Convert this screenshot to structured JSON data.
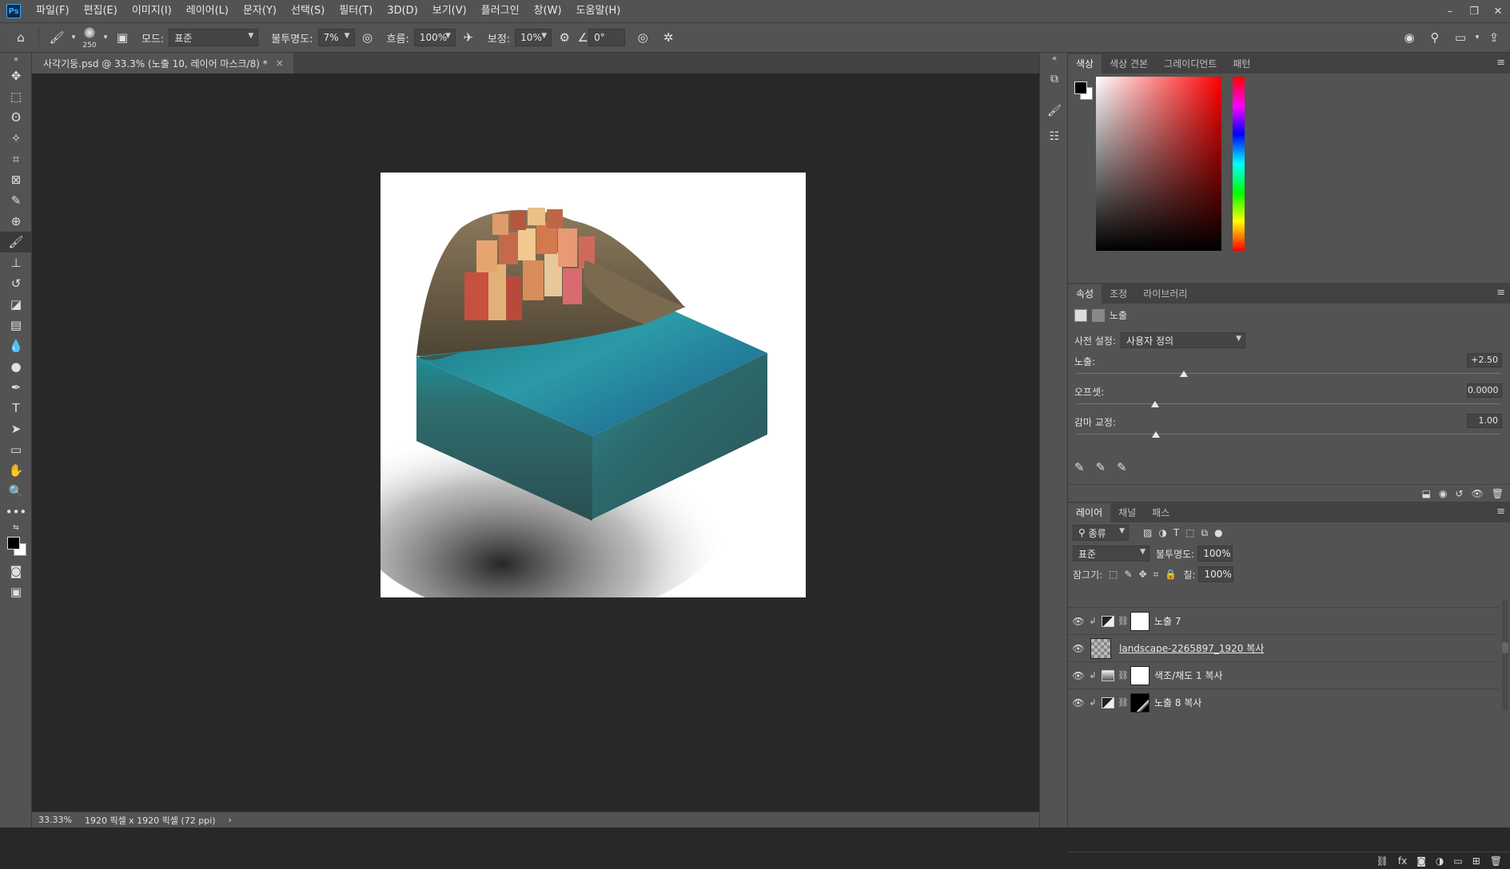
{
  "app": {
    "logo": "Ps"
  },
  "menu": [
    "파일(F)",
    "편집(E)",
    "이미지(I)",
    "레이어(L)",
    "문자(Y)",
    "선택(S)",
    "필터(T)",
    "3D(D)",
    "보기(V)",
    "플러그인",
    "창(W)",
    "도움말(H)"
  ],
  "window_controls": {
    "minimize": "–",
    "maximize": "❐",
    "close": "✕"
  },
  "options": {
    "brush_size": "250",
    "mode_label": "모드:",
    "mode_value": "표준",
    "opacity_label": "불투명도:",
    "opacity_value": "7%",
    "flow_label": "흐름:",
    "flow_value": "100%",
    "smoothing_label": "보정:",
    "smoothing_value": "10%",
    "angle_value": "0°"
  },
  "document": {
    "tab_title": "사각기둥.psd @ 33.3% (노출 10, 레이어 마스크/8) *",
    "close": "×"
  },
  "status": {
    "zoom": "33.33%",
    "doc_info": "1920 픽셀 x 1920 픽셀 (72 ppi)",
    "arrow": "›"
  },
  "color_panel": {
    "tabs": [
      "색상",
      "색상 견본",
      "그레이디언트",
      "패턴"
    ],
    "active_tab": 0
  },
  "properties_panel": {
    "tabs": [
      "속성",
      "조정",
      "라이브러리"
    ],
    "title": "노출",
    "preset_label": "사전 설정:",
    "preset_value": "사용자 정의",
    "exposure_label": "노출:",
    "exposure_value": "+2.50",
    "offset_label": "오프셋:",
    "offset_value": "0.0000",
    "gamma_label": "감마 교정:",
    "gamma_value": "1.00"
  },
  "layers_panel": {
    "tabs": [
      "레이어",
      "채널",
      "패스"
    ],
    "filter_value": "종류",
    "blend_value": "표준",
    "opacity_label": "불투명도:",
    "opacity_value": "100%",
    "lock_label": "잠그기:",
    "fill_label": "칠:",
    "fill_value": "100%",
    "layers": [
      {
        "name": "노출 7",
        "type": "adjustment",
        "mask": "white"
      },
      {
        "name": "landscape-2265897_1920 복사",
        "type": "pixel",
        "mask": ""
      },
      {
        "name": "색조/채도 1 복사",
        "type": "adjustment",
        "mask": "white"
      },
      {
        "name": "노출 8 복사",
        "type": "adjustment",
        "mask": "black"
      }
    ]
  },
  "colors": {
    "ui_dark": "#535353",
    "canvas_bg": "#282828",
    "water_top": "#1f7a86",
    "water_side": "#2d5d60"
  }
}
